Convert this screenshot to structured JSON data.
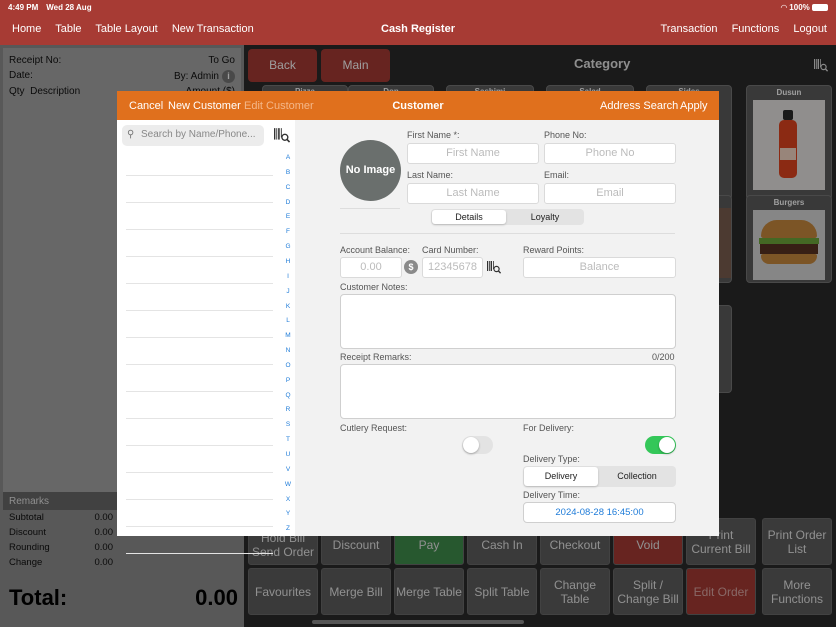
{
  "status": {
    "time": "4:49 PM",
    "date": "Wed 28 Aug",
    "battery": "100%"
  },
  "nav": {
    "left": [
      "Home",
      "Table",
      "Table Layout",
      "New Transaction"
    ],
    "title": "Cash Register",
    "right": [
      "Transaction",
      "Functions",
      "Logout"
    ]
  },
  "receipt": {
    "receipt_no_label": "Receipt No:",
    "receipt_no_value": "To Go",
    "date_label": "Date:",
    "by_value": "By: Admin",
    "qty_label": "Qty",
    "description_label": "Description",
    "amount_label": "Amount ($)",
    "remarks_label": "Remarks",
    "subtotal_label": "Subtotal",
    "subtotal_value": "0.00",
    "discount_label": "Discount",
    "discount_value": "0.00",
    "rounding_label": "Rounding",
    "rounding_value": "0.00",
    "change_label": "Change",
    "change_value": "0.00",
    "total_label": "Total:",
    "total_value": "0.00"
  },
  "main": {
    "back_label": "Back",
    "main_label": "Main",
    "category_title": "Category",
    "tiles": {
      "pizza": "Pizza",
      "don": "Don",
      "sashimi": "Sashimi",
      "salad": "Salad",
      "sides": "Sides",
      "dusun": "Dusun",
      "burgers": "Burgers"
    },
    "actions": {
      "hold_bill": "Hold Bill\nSend Order",
      "discount": "Discount",
      "pay": "Pay",
      "cash_in": "Cash In",
      "checkout": "Checkout",
      "void": "Void",
      "print_current_bill": "Print\nCurrent Bill",
      "print_order_list": "Print Order\nList",
      "favourites": "Favourites",
      "merge_bill": "Merge Bill",
      "merge_table": "Merge Table",
      "split_table": "Split Table",
      "change_table": "Change\nTable",
      "split_change_bill": "Split /\nChange Bill",
      "edit_order": "Edit Order",
      "more_functions": "More\nFunctions"
    }
  },
  "modal": {
    "cancel": "Cancel",
    "new_customer": "New Customer",
    "edit_customer": "Edit Customer",
    "title": "Customer",
    "address_search": "Address Search",
    "apply": "Apply",
    "search_placeholder": "Search by Name/Phone...",
    "alphabet": [
      "A",
      "B",
      "C",
      "D",
      "E",
      "F",
      "G",
      "H",
      "I",
      "J",
      "K",
      "L",
      "M",
      "N",
      "O",
      "P",
      "Q",
      "R",
      "S",
      "T",
      "U",
      "V",
      "W",
      "X",
      "Y",
      "Z"
    ],
    "no_image": "No Image",
    "first_name_label": "First Name *:",
    "first_name_placeholder": "First Name",
    "phone_label": "Phone No:",
    "phone_placeholder": "Phone No",
    "last_name_label": "Last Name:",
    "last_name_placeholder": "Last Name",
    "email_label": "Email:",
    "email_placeholder": "Email",
    "tab_details": "Details",
    "tab_loyalty": "Loyalty",
    "account_balance_label": "Account Balance:",
    "account_balance_value": "0.00",
    "card_number_label": "Card Number:",
    "card_number_placeholder": "12345678",
    "reward_points_label": "Reward Points:",
    "reward_points_placeholder": "Balance",
    "customer_notes_label": "Customer Notes:",
    "receipt_remarks_label": "Receipt Remarks:",
    "receipt_remarks_count": "0/200",
    "cutlery_label": "Cutlery Request:",
    "cutlery_on": false,
    "delivery_label": "For Delivery:",
    "delivery_on": true,
    "delivery_type_label": "Delivery Type:",
    "delivery_option": "Delivery",
    "collection_option": "Collection",
    "delivery_time_label": "Delivery Time:",
    "delivery_time_value": "2024-08-28 16:45:00"
  },
  "colors": {
    "brand_red": "#a73b34",
    "modal_orange": "#e0701d",
    "toggle_green": "#34c759",
    "pay_green": "#3f8f4c",
    "void_red": "#a73b34"
  }
}
